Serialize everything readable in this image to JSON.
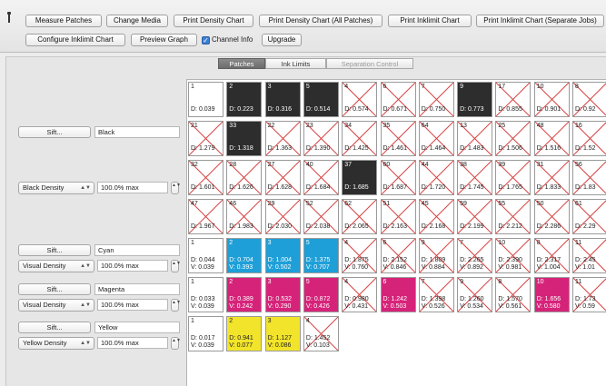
{
  "toolbar": {
    "row1": [
      {
        "label": "Measure Patches",
        "name": "measure-patches-button"
      },
      {
        "label": "Change Media",
        "name": "change-media-button"
      },
      {
        "label": "Print Density Chart",
        "name": "print-density-chart-button"
      },
      {
        "label": "Print Density Chart (All Patches)",
        "name": "print-density-chart-all-button"
      },
      {
        "label": "Print Inklimit Chart",
        "name": "print-inklimit-chart-button"
      },
      {
        "label": "Print Inklimit Chart (Separate Jobs)",
        "name": "print-inklimit-chart-separate-button"
      }
    ],
    "row2": [
      {
        "label": "Configure Inklimit Chart",
        "name": "configure-inklimit-chart-button"
      },
      {
        "label": "Preview Graph",
        "name": "preview-graph-button"
      },
      {
        "label": "Upgrade",
        "name": "upgrade-button"
      }
    ],
    "channel_info": {
      "label": "Channel Info",
      "checked": true
    }
  },
  "tabs": [
    {
      "label": "Patches",
      "state": "active"
    },
    {
      "label": "Ink Limits",
      "state": "normal"
    },
    {
      "label": "Separation Control",
      "state": "dim"
    }
  ],
  "sidebar": {
    "sift_label": "Sift...",
    "stepper_glyph": "▲▼",
    "channels": [
      {
        "name": "Black",
        "density": "Black Density",
        "max": "100.0% max"
      },
      {
        "name": "Cyan",
        "density": "Visual Density",
        "max": "100.0% max"
      },
      {
        "name": "Magenta",
        "density": "Visual Density",
        "max": "100.0% max"
      },
      {
        "name": "Yellow",
        "density": "Yellow Density",
        "max": "100.0% max"
      }
    ]
  },
  "colors": {
    "black": "#2d2d2d",
    "cyan": "#1e9fd8",
    "magenta": "#d6237a",
    "yellow": "#f2e42a",
    "cross": "#d64545"
  },
  "patches": {
    "black_rows": [
      [
        {
          "n": "1",
          "d": "D: 0.039",
          "fill": "white",
          "x": false
        },
        {
          "n": "2",
          "d": "D: 0.223",
          "fill": "black",
          "x": false
        },
        {
          "n": "3",
          "d": "D: 0.316",
          "fill": "black",
          "x": false
        },
        {
          "n": "5",
          "d": "D: 0.514",
          "fill": "black",
          "x": false
        },
        {
          "n": "4",
          "d": "D: 0.574",
          "fill": "white",
          "x": true
        },
        {
          "n": "6",
          "d": "D: 0.671",
          "fill": "white",
          "x": true
        },
        {
          "n": "7",
          "d": "D: 0.750",
          "fill": "white",
          "x": true
        },
        {
          "n": "9",
          "d": "D: 0.773",
          "fill": "black",
          "x": false
        },
        {
          "n": "17",
          "d": "D: 0.855",
          "fill": "white",
          "x": true
        },
        {
          "n": "10",
          "d": "D: 0.901",
          "fill": "white",
          "x": true
        },
        {
          "n": "8",
          "d": "D: 0.92",
          "fill": "white",
          "x": true
        }
      ],
      [
        {
          "n": "21",
          "d": "D: 1.279",
          "fill": "white",
          "x": true
        },
        {
          "n": "33",
          "d": "D: 1.318",
          "fill": "black",
          "x": false
        },
        {
          "n": "22",
          "d": "D: 1.363",
          "fill": "white",
          "x": true
        },
        {
          "n": "23",
          "d": "D: 1.390",
          "fill": "white",
          "x": true
        },
        {
          "n": "34",
          "d": "D: 1.425",
          "fill": "white",
          "x": true
        },
        {
          "n": "35",
          "d": "D: 1.461",
          "fill": "white",
          "x": true
        },
        {
          "n": "64",
          "d": "D: 1.464",
          "fill": "white",
          "x": true
        },
        {
          "n": "13",
          "d": "D: 1.483",
          "fill": "white",
          "x": true
        },
        {
          "n": "25",
          "d": "D: 1.506",
          "fill": "white",
          "x": true
        },
        {
          "n": "48",
          "d": "D: 1.516",
          "fill": "white",
          "x": true
        },
        {
          "n": "16",
          "d": "D: 1.52",
          "fill": "white",
          "x": true
        }
      ],
      [
        {
          "n": "32",
          "d": "D: 1.601",
          "fill": "white",
          "x": true
        },
        {
          "n": "28",
          "d": "D: 1.626",
          "fill": "white",
          "x": true
        },
        {
          "n": "27",
          "d": "D: 1.628",
          "fill": "white",
          "x": true
        },
        {
          "n": "40",
          "d": "D: 1.684",
          "fill": "white",
          "x": true
        },
        {
          "n": "37",
          "d": "D: 1.685",
          "fill": "black",
          "x": false
        },
        {
          "n": "60",
          "d": "D: 1.687",
          "fill": "white",
          "x": true
        },
        {
          "n": "44",
          "d": "D: 1.720",
          "fill": "white",
          "x": true
        },
        {
          "n": "38",
          "d": "D: 1.745",
          "fill": "white",
          "x": true
        },
        {
          "n": "39",
          "d": "D: 1.765",
          "fill": "white",
          "x": true
        },
        {
          "n": "31",
          "d": "D: 1.833",
          "fill": "white",
          "x": true
        },
        {
          "n": "56",
          "d": "D: 1.83",
          "fill": "white",
          "x": true
        }
      ],
      [
        {
          "n": "47",
          "d": "D: 1.967",
          "fill": "white",
          "x": true
        },
        {
          "n": "46",
          "d": "D: 1.983",
          "fill": "white",
          "x": true
        },
        {
          "n": "29",
          "d": "D: 2.030",
          "fill": "white",
          "x": true
        },
        {
          "n": "52",
          "d": "D: 2.038",
          "fill": "white",
          "x": true
        },
        {
          "n": "62",
          "d": "D: 2.065",
          "fill": "white",
          "x": true
        },
        {
          "n": "51",
          "d": "D: 2.163",
          "fill": "white",
          "x": true
        },
        {
          "n": "45",
          "d": "D: 2.168",
          "fill": "white",
          "x": true
        },
        {
          "n": "59",
          "d": "D: 2.199",
          "fill": "white",
          "x": true
        },
        {
          "n": "55",
          "d": "D: 2.212",
          "fill": "white",
          "x": true
        },
        {
          "n": "50",
          "d": "D: 2.286",
          "fill": "white",
          "x": true
        },
        {
          "n": "61",
          "d": "D: 2.29",
          "fill": "white",
          "x": true
        }
      ]
    ],
    "cyan_row": [
      {
        "n": "1",
        "d": "D: 0.044",
        "v": "V: 0.039",
        "fill": "white",
        "x": false
      },
      {
        "n": "2",
        "d": "D: 0.704",
        "v": "V: 0.393",
        "fill": "cyan",
        "x": false
      },
      {
        "n": "3",
        "d": "D: 1.004",
        "v": "V: 0.502",
        "fill": "cyan",
        "x": false
      },
      {
        "n": "5",
        "d": "D: 1.375",
        "v": "V: 0.707",
        "fill": "cyan",
        "x": false
      },
      {
        "n": "4",
        "d": "D: 1.875",
        "v": "V: 0.760",
        "fill": "white",
        "x": true
      },
      {
        "n": "6",
        "d": "D: 2.152",
        "v": "V: 0.846",
        "fill": "white",
        "x": true
      },
      {
        "n": "9",
        "d": "D: 1.809",
        "v": "V: 0.884",
        "fill": "white",
        "x": true
      },
      {
        "n": "7",
        "d": "D: 2.265",
        "v": "V: 0.892",
        "fill": "white",
        "x": true
      },
      {
        "n": "10",
        "d": "D: 2.390",
        "v": "V: 0.981",
        "fill": "white",
        "x": true
      },
      {
        "n": "8",
        "d": "D: 2.317",
        "v": "V: 1.004",
        "fill": "white",
        "x": true
      },
      {
        "n": "11",
        "d": "D: 2.45",
        "v": "V: 1.01",
        "fill": "white",
        "x": true
      }
    ],
    "magenta_row": [
      {
        "n": "1",
        "d": "D: 0.033",
        "v": "V: 0.039",
        "fill": "white",
        "x": false
      },
      {
        "n": "2",
        "d": "D: 0.389",
        "v": "V: 0.242",
        "fill": "magenta",
        "x": false
      },
      {
        "n": "3",
        "d": "D: 0.532",
        "v": "V: 0.290",
        "fill": "magenta",
        "x": false
      },
      {
        "n": "5",
        "d": "D: 0.872",
        "v": "V: 0.426",
        "fill": "magenta",
        "x": false
      },
      {
        "n": "4",
        "d": "D: 0.980",
        "v": "V: 0.431",
        "fill": "white",
        "x": true
      },
      {
        "n": "6",
        "d": "D: 1.242",
        "v": "V: 0.503",
        "fill": "magenta",
        "x": false
      },
      {
        "n": "7",
        "d": "D: 1.398",
        "v": "V: 0.526",
        "fill": "white",
        "x": true
      },
      {
        "n": "9",
        "d": "D: 1.260",
        "v": "V: 0.534",
        "fill": "white",
        "x": true
      },
      {
        "n": "8",
        "d": "D: 1.570",
        "v": "V: 0.561",
        "fill": "white",
        "x": true
      },
      {
        "n": "10",
        "d": "D: 1.656",
        "v": "V: 0.580",
        "fill": "magenta",
        "x": false
      },
      {
        "n": "11",
        "d": "D: 1.73",
        "v": "V: 0.59",
        "fill": "white",
        "x": true
      }
    ],
    "yellow_row": [
      {
        "n": "1",
        "d": "D: 0.017",
        "v": "V: 0.039",
        "fill": "white",
        "x": false
      },
      {
        "n": "2",
        "d": "D: 0.941",
        "v": "V: 0.077",
        "fill": "yellow",
        "x": false
      },
      {
        "n": "3",
        "d": "D: 1.127",
        "v": "V: 0.086",
        "fill": "yellow",
        "x": false
      },
      {
        "n": "4",
        "d": "D: 1.452",
        "v": "V: 0.103",
        "fill": "white",
        "x": true
      }
    ]
  }
}
